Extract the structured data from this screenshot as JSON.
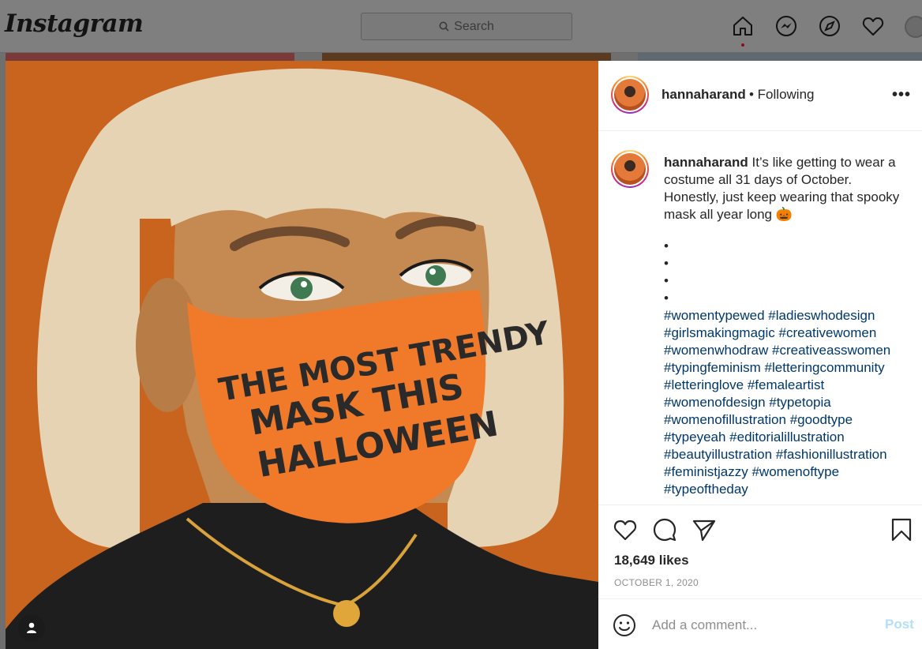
{
  "app": {
    "logo": "Instagram"
  },
  "search": {
    "placeholder": "Search"
  },
  "nav": {
    "icons": [
      "home-icon",
      "messenger-icon",
      "explore-icon",
      "heart-icon",
      "profile-avatar"
    ]
  },
  "post": {
    "image": {
      "mask_text": [
        "THE MOST TRENDY",
        "MASK THIS",
        "HALLOWEEN"
      ],
      "colors": {
        "background": "#c9641f",
        "hair": "#e6d3b3",
        "mask": "#f07a2a",
        "sweater": "#1e1e1e"
      }
    },
    "header": {
      "username": "hannaharand",
      "following": "• Following"
    },
    "caption": {
      "username": "hannaharand",
      "text": "It’s like getting to wear a costume all 31 days of October. Honestly, just keep wearing that spooky mask all year long 🎃",
      "dots": [
        "•",
        "•",
        "•",
        "•"
      ],
      "hashtags": "#womentypewed #ladieswhodesign #girlsmakingmagic #creativewomen #womenwhodraw #creativeasswomen #typingfeminism #letteringcommunity #letteringlove #femaleartist #womenofdesign #typetopia #womenofillustration #goodtype #typeyeah #editorialillustration #beautyillustration #fashionillustration #feministjazzy #womenoftype #typeoftheday"
    },
    "likes": "18,649 likes",
    "date": "OCTOBER 1, 2020",
    "comment": {
      "placeholder": "Add a comment...",
      "post_label": "Post"
    }
  }
}
